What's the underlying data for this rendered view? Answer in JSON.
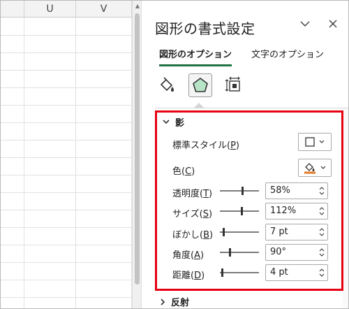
{
  "sheet": {
    "columns": [
      "U",
      "V"
    ]
  },
  "pane": {
    "title": "図形の書式設定",
    "tabs": [
      {
        "label": "図形のオプション",
        "active": true
      },
      {
        "label": "文字のオプション",
        "active": false
      }
    ],
    "icons": [
      "fill-line-icon",
      "effects-pentagon-icon",
      "size-properties-icon"
    ]
  },
  "shadow": {
    "header": "影",
    "preset_label": "標準スタイル(",
    "preset_key": "P",
    "color_label": "色(",
    "color_key": "C",
    "color_accent": "#e07a2a",
    "transparency_label": "透明度(",
    "transparency_key": "T",
    "transparency_value": "58%",
    "transparency_level": 0.58,
    "size_label": "サイズ(",
    "size_key": "S",
    "size_value": "112%",
    "size_level": 0.56,
    "blur_label": "ぼかし(",
    "blur_key": "B",
    "blur_value": "7 pt",
    "blur_level": 0.07,
    "angle_label": "角度(",
    "angle_key": "A",
    "angle_value": "90°",
    "angle_level": 0.25,
    "distance_label": "距離(",
    "distance_key": "D",
    "distance_value": "4 pt",
    "distance_level": 0.04,
    "paren_close": ")"
  },
  "reflection": {
    "header": "反射"
  },
  "colors": {
    "highlight_border": "#e60012",
    "active_tab_underline": "#217346",
    "effects_icon_fill": "#b7e4c7"
  }
}
